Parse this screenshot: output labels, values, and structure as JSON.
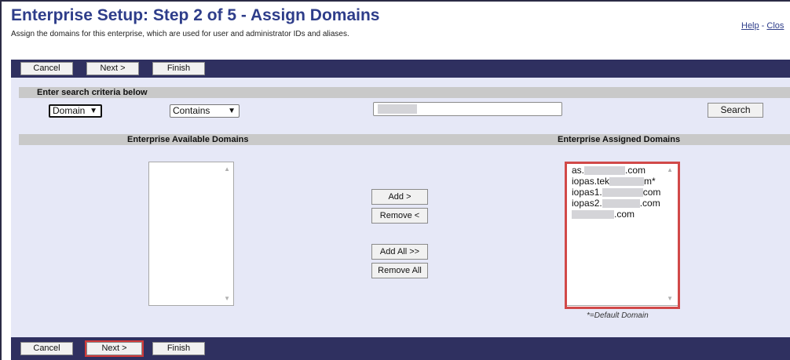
{
  "header": {
    "title": "Enterprise Setup: Step 2 of 5 - Assign Domains",
    "subtitle": "Assign the domains for this enterprise, which are used for user and administrator IDs and aliases.",
    "help_label": "Help",
    "separator": " - ",
    "close_label": "Clos"
  },
  "toolbar": {
    "cancel_label": "Cancel",
    "next_label": "Next >",
    "finish_label": "Finish"
  },
  "search": {
    "section_label": "Enter search criteria below",
    "field_select_value": "Domain",
    "operator_select_value": "Contains",
    "search_value": "",
    "search_button_label": "Search"
  },
  "available": {
    "header": "Enterprise Available Domains",
    "items": []
  },
  "assigned": {
    "header": "Enterprise Assigned Domains",
    "items": [
      {
        "prefix": "as.",
        "suffix": ".com"
      },
      {
        "prefix": "iopas.tek",
        "suffix": "m*"
      },
      {
        "prefix": "iopas1.",
        "suffix": "com"
      },
      {
        "prefix": "iopas2.",
        "suffix": ".com"
      },
      {
        "prefix": "",
        "suffix": ".com"
      }
    ],
    "default_note": "*=Default Domain"
  },
  "transfer": {
    "add_label": "Add >",
    "remove_label": "Remove <",
    "add_all_label": "Add All >>",
    "remove_all_label": "Remove All"
  },
  "colors": {
    "title": "#2e3d8a",
    "bar": "#2f3060",
    "panel": "#e6e8f7",
    "band": "#c9c9c9",
    "highlight": "#d14949"
  }
}
